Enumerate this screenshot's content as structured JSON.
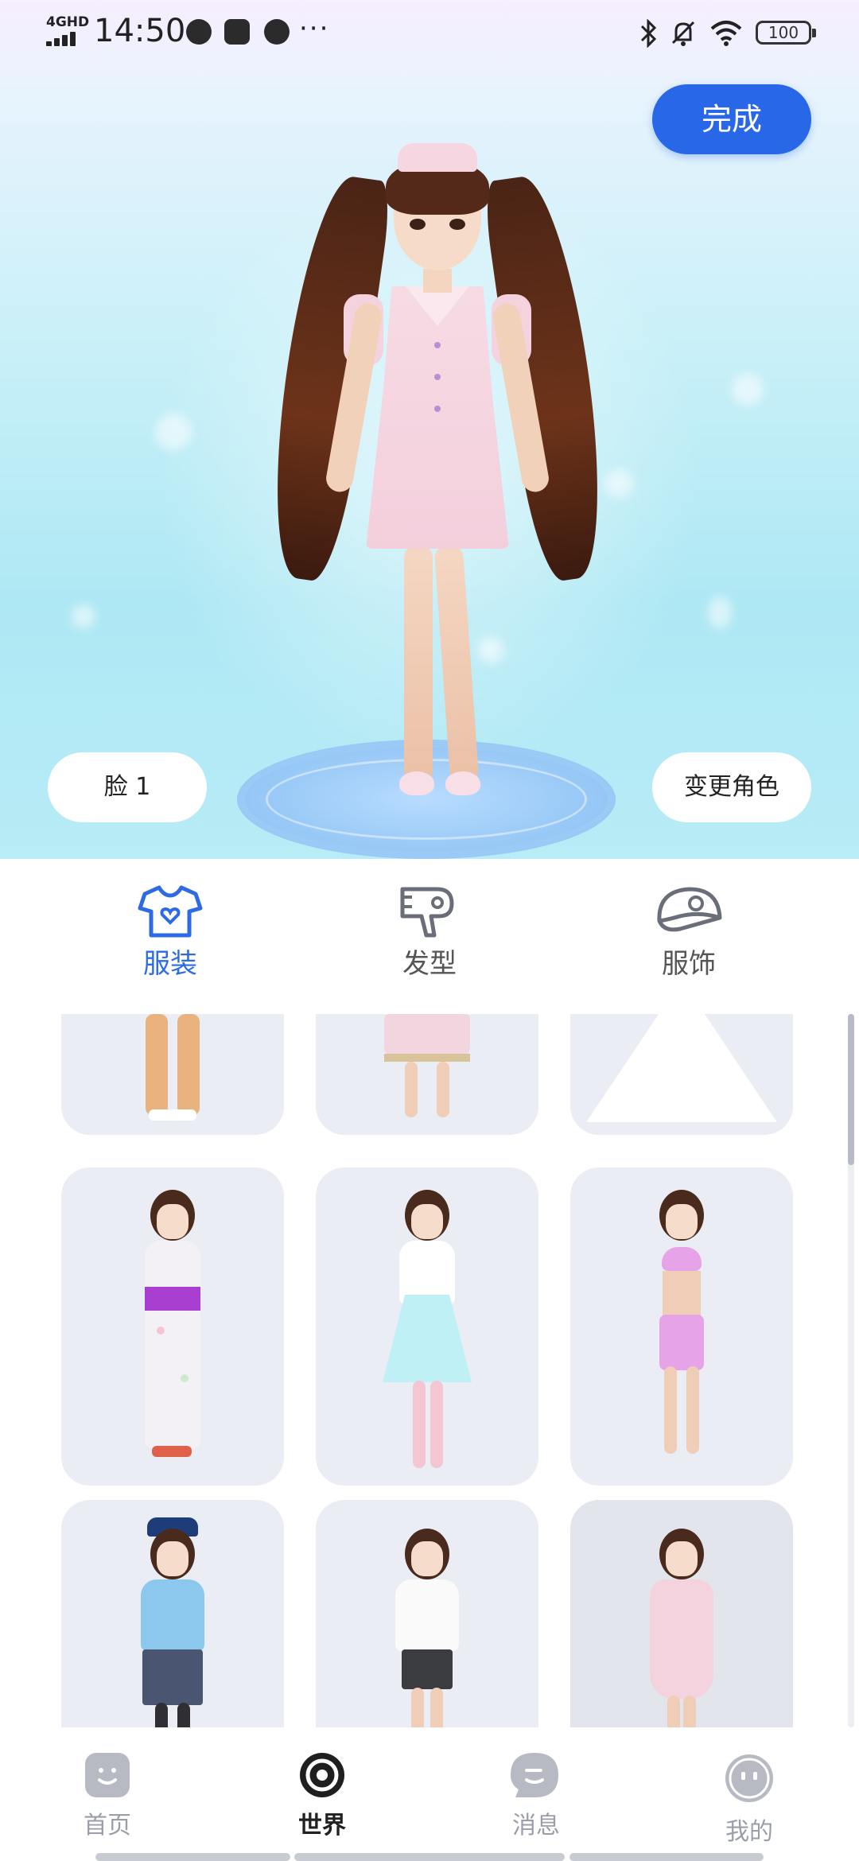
{
  "status_bar": {
    "network": "4GHD",
    "time": "14:50",
    "more": "···",
    "battery": "100"
  },
  "header": {
    "done_label": "完成"
  },
  "stage": {
    "face_label": "脸 1",
    "change_role_label": "变更角色"
  },
  "category_tabs": [
    {
      "label": "服装",
      "icon": "tshirt-icon",
      "active": true
    },
    {
      "label": "发型",
      "icon": "hairdryer-icon",
      "active": false
    },
    {
      "label": "服饰",
      "icon": "cap-icon",
      "active": false
    }
  ],
  "outfits": [
    {
      "name": "tan-trousers",
      "color": "#e8b37e"
    },
    {
      "name": "pink-skirt",
      "color": "#f1d6df"
    },
    {
      "name": "white-gown",
      "color": "#ffffff"
    },
    {
      "name": "floral-yukata",
      "color": "#f4f1f6"
    },
    {
      "name": "maid-dress",
      "color": "#bff0f6"
    },
    {
      "name": "pink-sportswear",
      "color": "#e7a3e8"
    },
    {
      "name": "police-uniform",
      "color": "#8cc7ee"
    },
    {
      "name": "office-blouse",
      "color": "#fafafa"
    },
    {
      "name": "nurse-dress",
      "color": "#f5d3de"
    }
  ],
  "bottom_nav": [
    {
      "label": "首页",
      "icon": "home-face-icon",
      "active": false
    },
    {
      "label": "世界",
      "icon": "world-ring-icon",
      "active": true
    },
    {
      "label": "消息",
      "icon": "message-bubble-icon",
      "active": false
    },
    {
      "label": "我的",
      "icon": "profile-face-icon",
      "active": false
    }
  ],
  "colors": {
    "accent": "#2867e8",
    "tab_active": "#2d6be6",
    "nav_inactive": "#9a9ea8",
    "card_bg": "#eaedf3"
  }
}
